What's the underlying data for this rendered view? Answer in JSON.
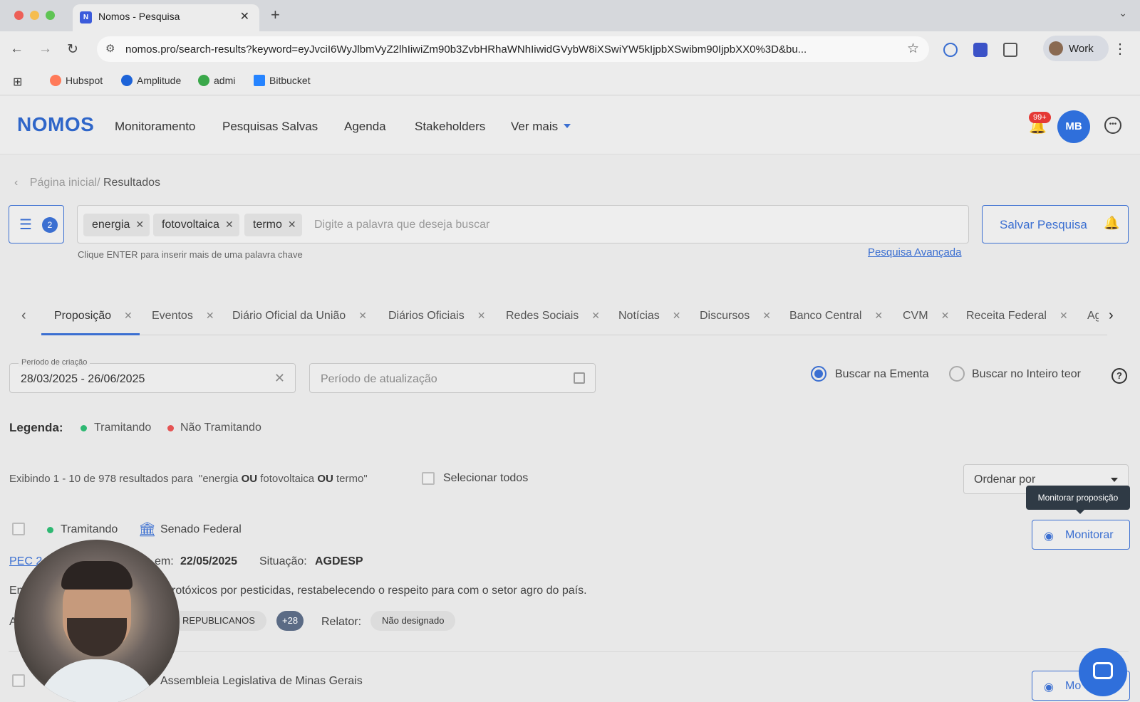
{
  "browser": {
    "tab_title": "Nomos - Pesquisa",
    "tab_close": "✕",
    "new_tab": "+",
    "url": "nomos.pro/search-results?keyword=eyJvciI6WyJlbmVyZ2lhIiwiZm90b3ZvbHRhaWNhIiwidGVybW8iXSwiYW5kIjpbXSwibm90IjpbXX0%3D&bu...",
    "profile": "Work",
    "bookmarks": [
      "Hubspot",
      "Amplitude",
      "admi",
      "Bitbucket"
    ],
    "bookmark_colors": [
      "#ff7a59",
      "#1d63d8",
      "#3aa84a",
      "#2684ff"
    ]
  },
  "app": {
    "logo": "NOMOS",
    "nav": [
      "Monitoramento",
      "Pesquisas Salvas",
      "Agenda",
      "Stakeholders",
      "Ver mais"
    ],
    "notifications": "99+",
    "avatar": "MB",
    "accent_color": "#3b6fd1"
  },
  "breadcrumb": {
    "home": "Página inicial/",
    "current": "Resultados"
  },
  "search": {
    "filter_count": "2",
    "keywords": [
      "energia",
      "fotovoltaica",
      "termo"
    ],
    "placeholder": "Digite a palavra que deseja buscar",
    "hint": "Clique ENTER para inserir mais de uma palavra chave",
    "advanced_link": "Pesquisa Avançada",
    "save_button": "Salvar Pesquisa"
  },
  "categories": [
    "Proposição",
    "Eventos",
    "Diário Oficial da União",
    "Diários Oficiais",
    "Redes Sociais",
    "Notícias",
    "Discursos",
    "Banco Central",
    "CVM",
    "Receita Federal",
    "Ag"
  ],
  "active_category": "Proposição",
  "filters": {
    "creation_label": "Período de criação",
    "creation_value": "28/03/2025 - 26/06/2025",
    "update_placeholder": "Período de atualização",
    "radio_ementa": "Buscar na Ementa",
    "radio_inteiro": "Buscar no Inteiro teor",
    "selected_radio": "Buscar na Ementa"
  },
  "legend": {
    "title": "Legenda:",
    "items": [
      {
        "label": "Tramitando",
        "color": "#2eb872"
      },
      {
        "label": "Não Tramitando",
        "color": "#e55353"
      }
    ]
  },
  "results": {
    "prefix": "Exibindo 1 - 10 de 978 resultados para",
    "q_open": "\"energia",
    "op1": "OU",
    "q_mid": "fotovoltaica",
    "op2": "OU",
    "q_end": "termo\"",
    "select_all": "Selecionar todos",
    "sort_label": "Ordenar por"
  },
  "tooltip": "Monitorar proposição",
  "cards": [
    {
      "status": "Tramitando",
      "house": "Senado Federal",
      "id": "PEC 2",
      "date_label": "em:",
      "date": "22/05/2025",
      "situation_label": "Situação:",
      "situation": "AGDESP",
      "ementa_prefix": "Em",
      "ementa": "rotóxicos por pesticidas, restabelecendo o respeito para com o setor agro do país.",
      "author_prefix": "A",
      "party": "REPUBLICANOS",
      "more": "+28",
      "relator_label": "Relator:",
      "relator": "Não designado",
      "monitor": "Monitorar"
    },
    {
      "house": "Assembleia Legislativa de Minas Gerais",
      "monitor": "Mo"
    }
  ]
}
